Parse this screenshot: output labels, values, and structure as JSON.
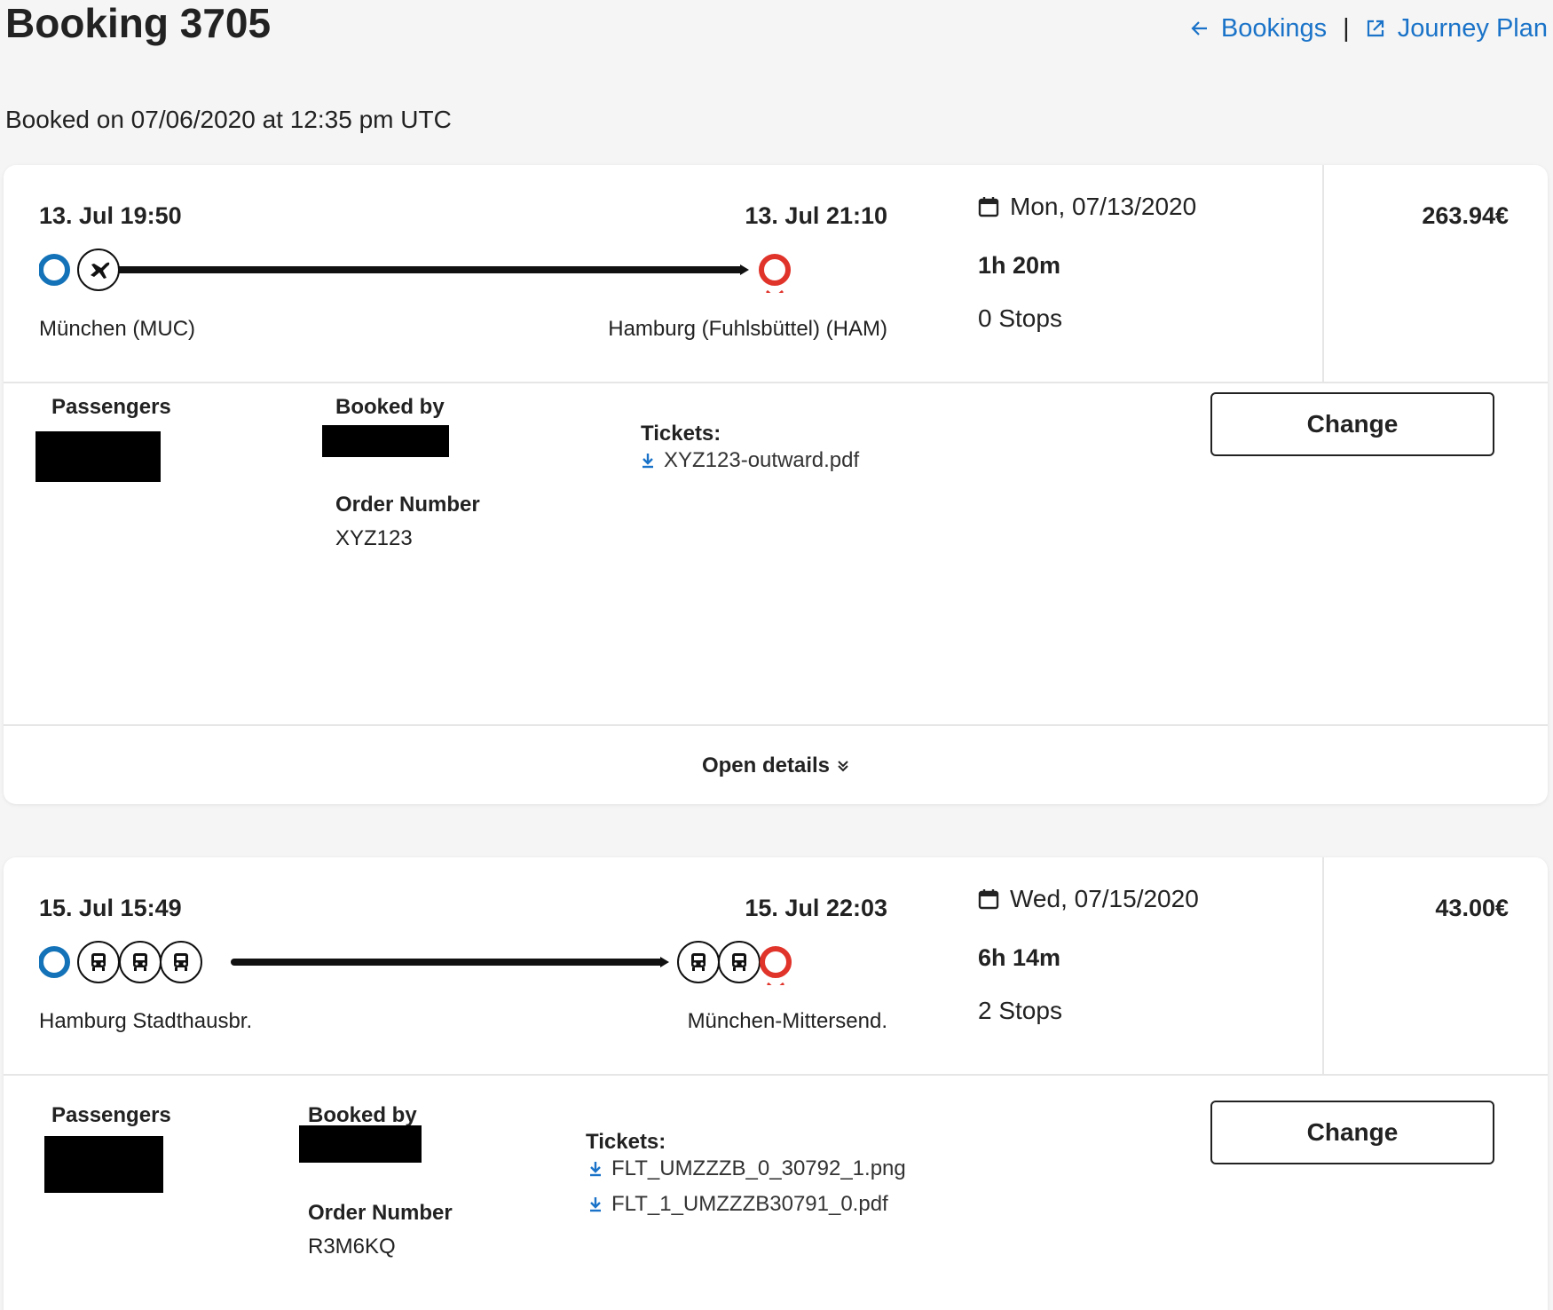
{
  "header": {
    "title": "Booking 3705",
    "booked_on": "Booked on 07/06/2020 at 12:35 pm UTC",
    "back_link": "Bookings",
    "separator": "|",
    "journey_link": "Journey Plan"
  },
  "bookings": [
    {
      "departure": "13. Jul 19:50",
      "arrival": "13. Jul 21:10",
      "origin": "München (MUC)",
      "destination": "Hamburg (Fuhlsbüttel) (HAM)",
      "date": "Mon, 07/13/2020",
      "duration": "1h 20m",
      "stops": "0 Stops",
      "price": "263.94€",
      "legs": [
        "plane-icon"
      ],
      "passengers_label": "Passengers",
      "booked_by_label": "Booked by",
      "order_number_label": "Order Number",
      "order_number": "XYZ123",
      "tickets_label": "Tickets:",
      "tickets": [
        "XYZ123-outward.pdf"
      ],
      "change_label": "Change",
      "open_details_label": "Open details"
    },
    {
      "departure": "15. Jul 15:49",
      "arrival": "15. Jul 22:03",
      "origin": "Hamburg Stadthausbr.",
      "destination": "München-Mittersend.",
      "date": "Wed, 07/15/2020",
      "duration": "6h 14m",
      "stops": "2 Stops",
      "price": "43.00€",
      "legs": [
        "bus-icon",
        "bus-icon",
        "bus-icon",
        "bus-icon",
        "bus-icon"
      ],
      "passengers_label": "Passengers",
      "booked_by_label": "Booked by",
      "order_number_label": "Order Number",
      "order_number": "R3M6KQ",
      "tickets_label": "Tickets:",
      "tickets": [
        "FLT_UMZZZB_0_30792_1.png",
        "FLT_1_UMZZZB30791_0.pdf"
      ],
      "change_label": "Change"
    }
  ],
  "colors": {
    "link": "#1a73c8",
    "origin_marker": "#1473b8",
    "destination_marker": "#e0332a",
    "text": "#222222"
  }
}
